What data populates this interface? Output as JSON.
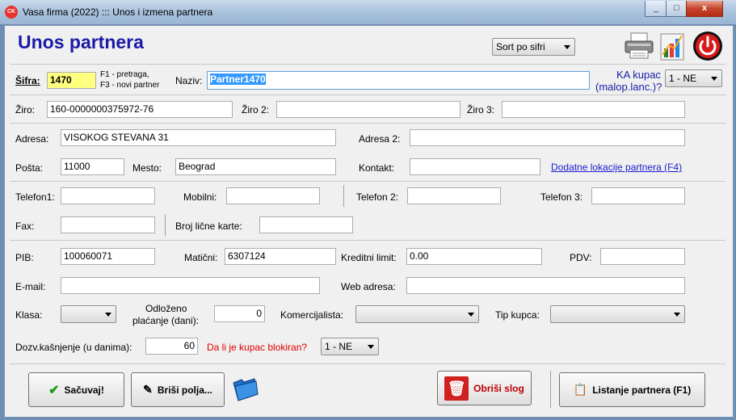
{
  "window": {
    "title": "Vasa firma (2022) ::: Unos i izmena partnera",
    "min": "_",
    "max": "□",
    "close": "x"
  },
  "header": {
    "title": "Unos partnera",
    "sort": "Sort po sifri"
  },
  "sifra": {
    "label": "Šifra:",
    "value": "1470",
    "hint1": "F1 - pretraga,",
    "hint2": "F3 - novi partner"
  },
  "naziv": {
    "label": "Naziv:",
    "value": "Partner1470"
  },
  "ka": {
    "label1": "KA kupac",
    "label2": "(malop.lanc.)?",
    "value": "1 - NE"
  },
  "ziro": {
    "label": "Žiro:",
    "value": "160-0000000375972-76",
    "label2": "Žiro 2:",
    "value2": "",
    "label3": "Žiro 3:",
    "value3": ""
  },
  "adresa": {
    "label": "Adresa:",
    "value": "VISOKOG STEVANA  31",
    "label2": "Adresa 2:",
    "value2": ""
  },
  "posta": {
    "label": "Pošta:",
    "value": "11000",
    "mesto_label": "Mesto:",
    "mesto": "Beograd",
    "kontakt_label": "Kontakt:",
    "kontakt": "",
    "link": "Dodatne lokacije partnera (F4)"
  },
  "telefon": {
    "t1_label": "Telefon1:",
    "t1": "",
    "mob_label": "Mobilni:",
    "mob": "",
    "t2_label": "Telefon 2:",
    "t2": "",
    "t3_label": "Telefon 3:",
    "t3": ""
  },
  "fax": {
    "label": "Fax:",
    "value": "",
    "bk_label": "Broj lične karte:",
    "bk": ""
  },
  "pib": {
    "label": "PIB:",
    "value": "100060071",
    "mat_label": "Matični:",
    "mat": "6307124",
    "kl_label": "Kreditni limit:",
    "kl": "0.00",
    "pdv_label": "PDV:",
    "pdv": ""
  },
  "email": {
    "label": "E-mail:",
    "value": "",
    "web_label": "Web adresa:",
    "web": ""
  },
  "klasa": {
    "label": "Klasa:",
    "value": "",
    "odl1": "Odloženo",
    "odl2": "plaćanje (dani):",
    "odl": "0",
    "kom_label": "Komercijalista:",
    "kom": "",
    "tip_label": "Tip kupca:",
    "tip": ""
  },
  "dozv": {
    "label": "Dozv.kašnjenje (u danima):",
    "value": "60",
    "blok_label": "Da li je kupac blokiran?",
    "blok": "1 - NE"
  },
  "buttons": {
    "save": "Sačuvaj!",
    "clear": "Briši polja...",
    "delete": "Obriši slog",
    "list": "Listanje partnera (F1)"
  },
  "colors": {
    "heading": "#1a1aa8",
    "sifra_bg": "#ffff80",
    "link": "#1a1ad0",
    "blocked": "#e00000"
  }
}
